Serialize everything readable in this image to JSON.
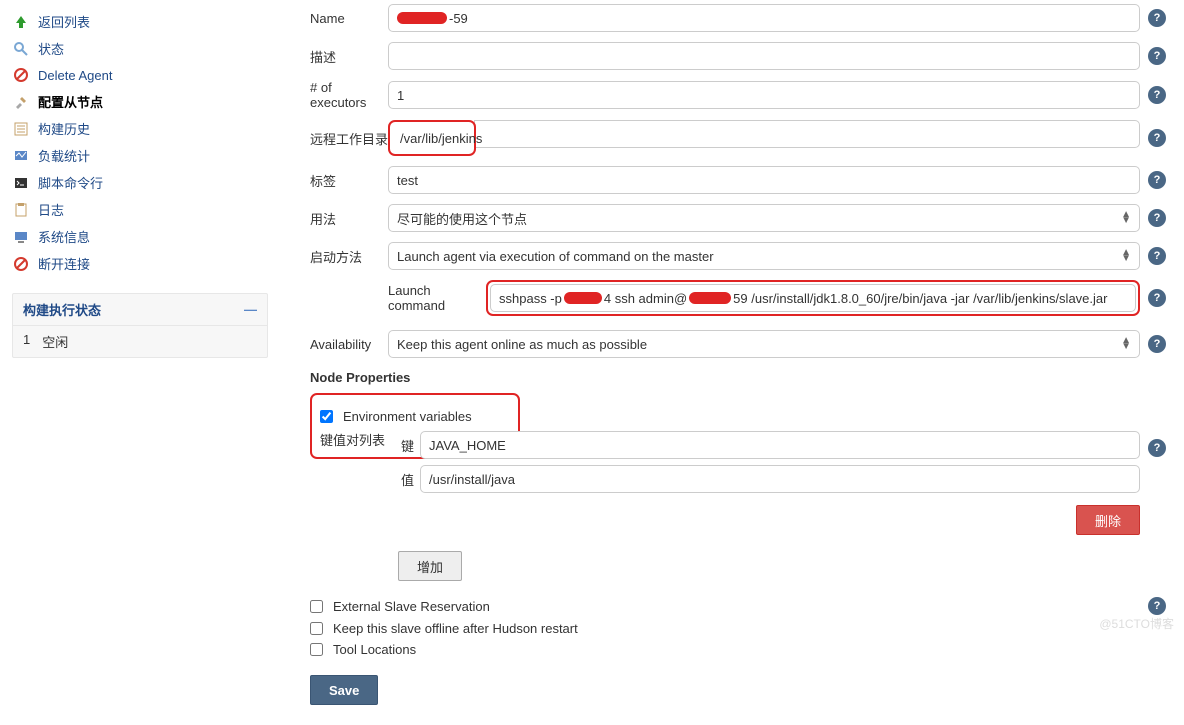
{
  "sidebar": {
    "items": [
      {
        "label": "返回列表"
      },
      {
        "label": "状态"
      },
      {
        "label": "Delete Agent"
      },
      {
        "label": "配置从节点"
      },
      {
        "label": "构建历史"
      },
      {
        "label": "负载统计"
      },
      {
        "label": "脚本命令行"
      },
      {
        "label": "日志"
      },
      {
        "label": "系统信息"
      },
      {
        "label": "断开连接"
      }
    ],
    "executor_panel": {
      "title": "构建执行状态",
      "collapse": "—",
      "rows": [
        {
          "num": "1",
          "status": "空闲"
        }
      ]
    }
  },
  "form": {
    "name_label": "Name",
    "name_suffix": "-59",
    "desc_label": "描述",
    "desc_value": "",
    "executors_label": "# of executors",
    "executors_value": "1",
    "remote_label": "远程工作目录",
    "remote_value": "/var/lib/jenkins",
    "tags_label": "标签",
    "tags_value": "test",
    "usage_label": "用法",
    "usage_value": "尽可能的使用这个节点",
    "launch_label": "启动方法",
    "launch_value": "Launch agent via execution of command on the master",
    "launch_cmd_label": "Launch command",
    "launch_cmd_prefix": "sshpass -p ",
    "launch_cmd_mid1": "4  ssh admin@",
    "launch_cmd_mid2": "59 /usr/install/jdk1.8.0_60/jre/bin/java -jar /var/lib/jenkins/slave.jar",
    "availability_label": "Availability",
    "availability_value": "Keep this agent online as much as possible",
    "node_props_title": "Node Properties",
    "env_vars_label": "Environment variables",
    "kv_list_label": "键值对列表",
    "key_label": "键",
    "key_value": "JAVA_HOME",
    "val_label": "值",
    "val_value": "/usr/install/java",
    "delete_btn": "删除",
    "add_btn": "增加",
    "ext_slave_label": "External Slave Reservation",
    "keep_offline_label": "Keep this slave offline after Hudson restart",
    "tool_loc_label": "Tool Locations",
    "save_btn": "Save"
  },
  "watermark": "@51CTO博客"
}
